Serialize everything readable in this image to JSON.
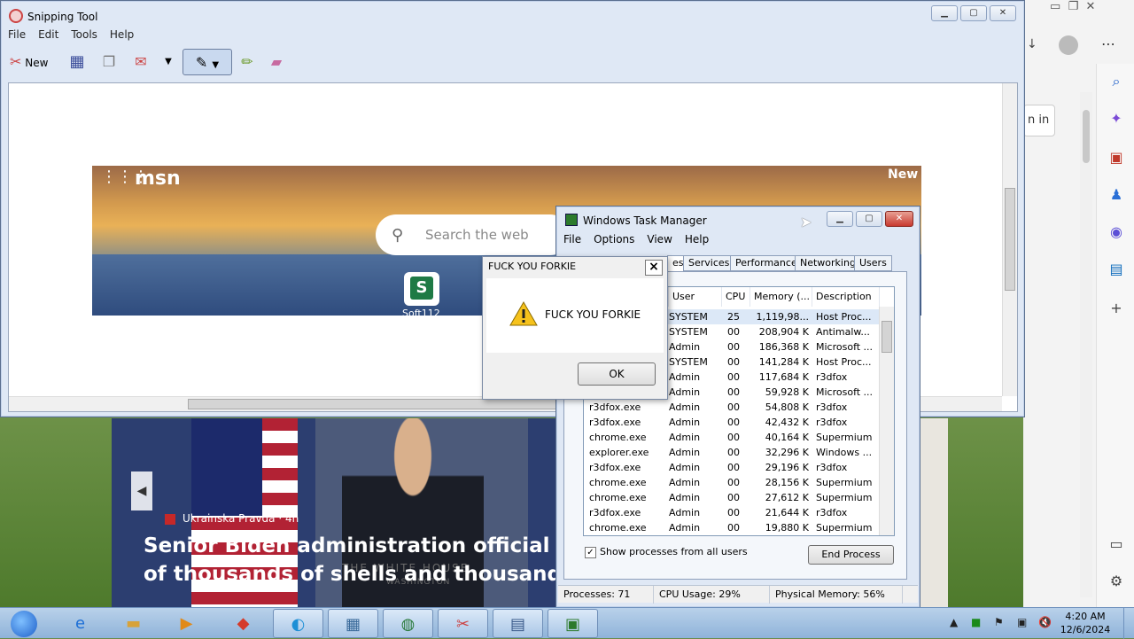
{
  "snipping": {
    "title": "Snipping Tool",
    "menu": [
      "File",
      "Edit",
      "Tools",
      "Help"
    ],
    "new_label": "New"
  },
  "msn": {
    "logo": "msn",
    "new_label": "New",
    "search_placeholder": "Search the web",
    "tile_letter": "S",
    "tile_label": "Soft112"
  },
  "edge": {
    "signin": "n in"
  },
  "news": {
    "source": "Ukrainska Pravda · 4h",
    "headline_line1": "Senior Biden administration official vows h",
    "headline_line2": "of thousands of shells and thousands of mi",
    "podium_text": "THE WHITE HOUSE",
    "podium_sub": "WASHINGTON"
  },
  "taskmanager": {
    "title": "Windows Task Manager",
    "menu": [
      "File",
      "Options",
      "View",
      "Help"
    ],
    "tabs": [
      "es",
      "Services",
      "Performance",
      "Networking",
      "Users"
    ],
    "columns": [
      "User Name",
      "CPU",
      "Memory (...",
      "Description"
    ],
    "rows": [
      {
        "image": "",
        "user": "SYSTEM",
        "cpu": "25",
        "mem": "1,119,98...",
        "desc": "Host Proc..."
      },
      {
        "image": "",
        "user": "SYSTEM",
        "cpu": "00",
        "mem": "208,904 K",
        "desc": "Antimalw..."
      },
      {
        "image": "",
        "user": "Admin",
        "cpu": "00",
        "mem": "186,368 K",
        "desc": "Microsoft ..."
      },
      {
        "image": "",
        "user": "SYSTEM",
        "cpu": "00",
        "mem": "141,284 K",
        "desc": "Host Proc..."
      },
      {
        "image": "",
        "user": "Admin",
        "cpu": "00",
        "mem": "117,684 K",
        "desc": "r3dfox"
      },
      {
        "image": "",
        "user": "Admin",
        "cpu": "00",
        "mem": "59,928 K",
        "desc": "Microsoft ..."
      },
      {
        "image": "r3dfox.exe",
        "user": "Admin",
        "cpu": "00",
        "mem": "54,808 K",
        "desc": "r3dfox"
      },
      {
        "image": "r3dfox.exe",
        "user": "Admin",
        "cpu": "00",
        "mem": "42,432 K",
        "desc": "r3dfox"
      },
      {
        "image": "chrome.exe",
        "user": "Admin",
        "cpu": "00",
        "mem": "40,164 K",
        "desc": "Supermium"
      },
      {
        "image": "explorer.exe",
        "user": "Admin",
        "cpu": "00",
        "mem": "32,296 K",
        "desc": "Windows ..."
      },
      {
        "image": "r3dfox.exe",
        "user": "Admin",
        "cpu": "00",
        "mem": "29,196 K",
        "desc": "r3dfox"
      },
      {
        "image": "chrome.exe",
        "user": "Admin",
        "cpu": "00",
        "mem": "28,156 K",
        "desc": "Supermium"
      },
      {
        "image": "chrome.exe",
        "user": "Admin",
        "cpu": "00",
        "mem": "27,612 K",
        "desc": "Supermium"
      },
      {
        "image": "r3dfox.exe",
        "user": "Admin",
        "cpu": "00",
        "mem": "21,644 K",
        "desc": "r3dfox"
      },
      {
        "image": "chrome.exe",
        "user": "Admin",
        "cpu": "00",
        "mem": "19,880 K",
        "desc": "Supermium"
      }
    ],
    "show_all_label": "Show processes from all users",
    "end_process": "End Process",
    "status_processes": "Processes: 71",
    "status_cpu": "CPU Usage: 29%",
    "status_mem": "Physical Memory: 56%"
  },
  "dialog": {
    "title": "FUCK YOU FORKIE",
    "message": "FUCK YOU FORKIE",
    "ok": "OK"
  },
  "taskbar": {
    "time": "4:20 AM",
    "date": "12/6/2024"
  },
  "colors": {
    "accent": "#dfe8f5",
    "taskbar": "#a8c4e2",
    "close_red": "#c8392f"
  }
}
